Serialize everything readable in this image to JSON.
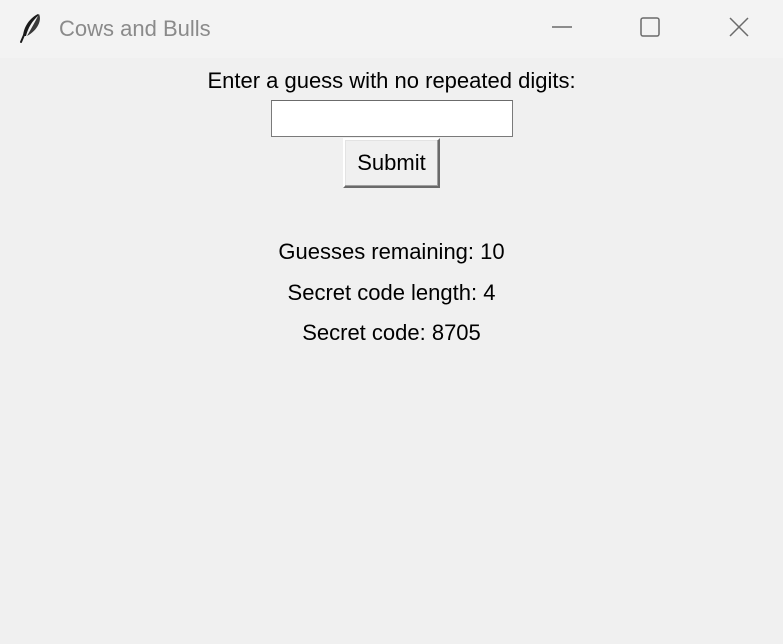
{
  "window": {
    "title": "Cows and Bulls",
    "icon": "feather-icon",
    "controls": {
      "minimize_icon": "minimize-icon",
      "maximize_icon": "maximize-icon",
      "close_icon": "close-icon"
    }
  },
  "form": {
    "prompt": "Enter a guess with no repeated digits:",
    "guess_value": "",
    "submit_label": "Submit"
  },
  "status": {
    "guesses_remaining": "Guesses remaining: 10",
    "code_length": "Secret code length: 4",
    "secret_code": "Secret code: 8705"
  },
  "colors": {
    "background": "#f0f0f0",
    "title_text": "#8a8a8a",
    "input_background": "#ffffff"
  }
}
